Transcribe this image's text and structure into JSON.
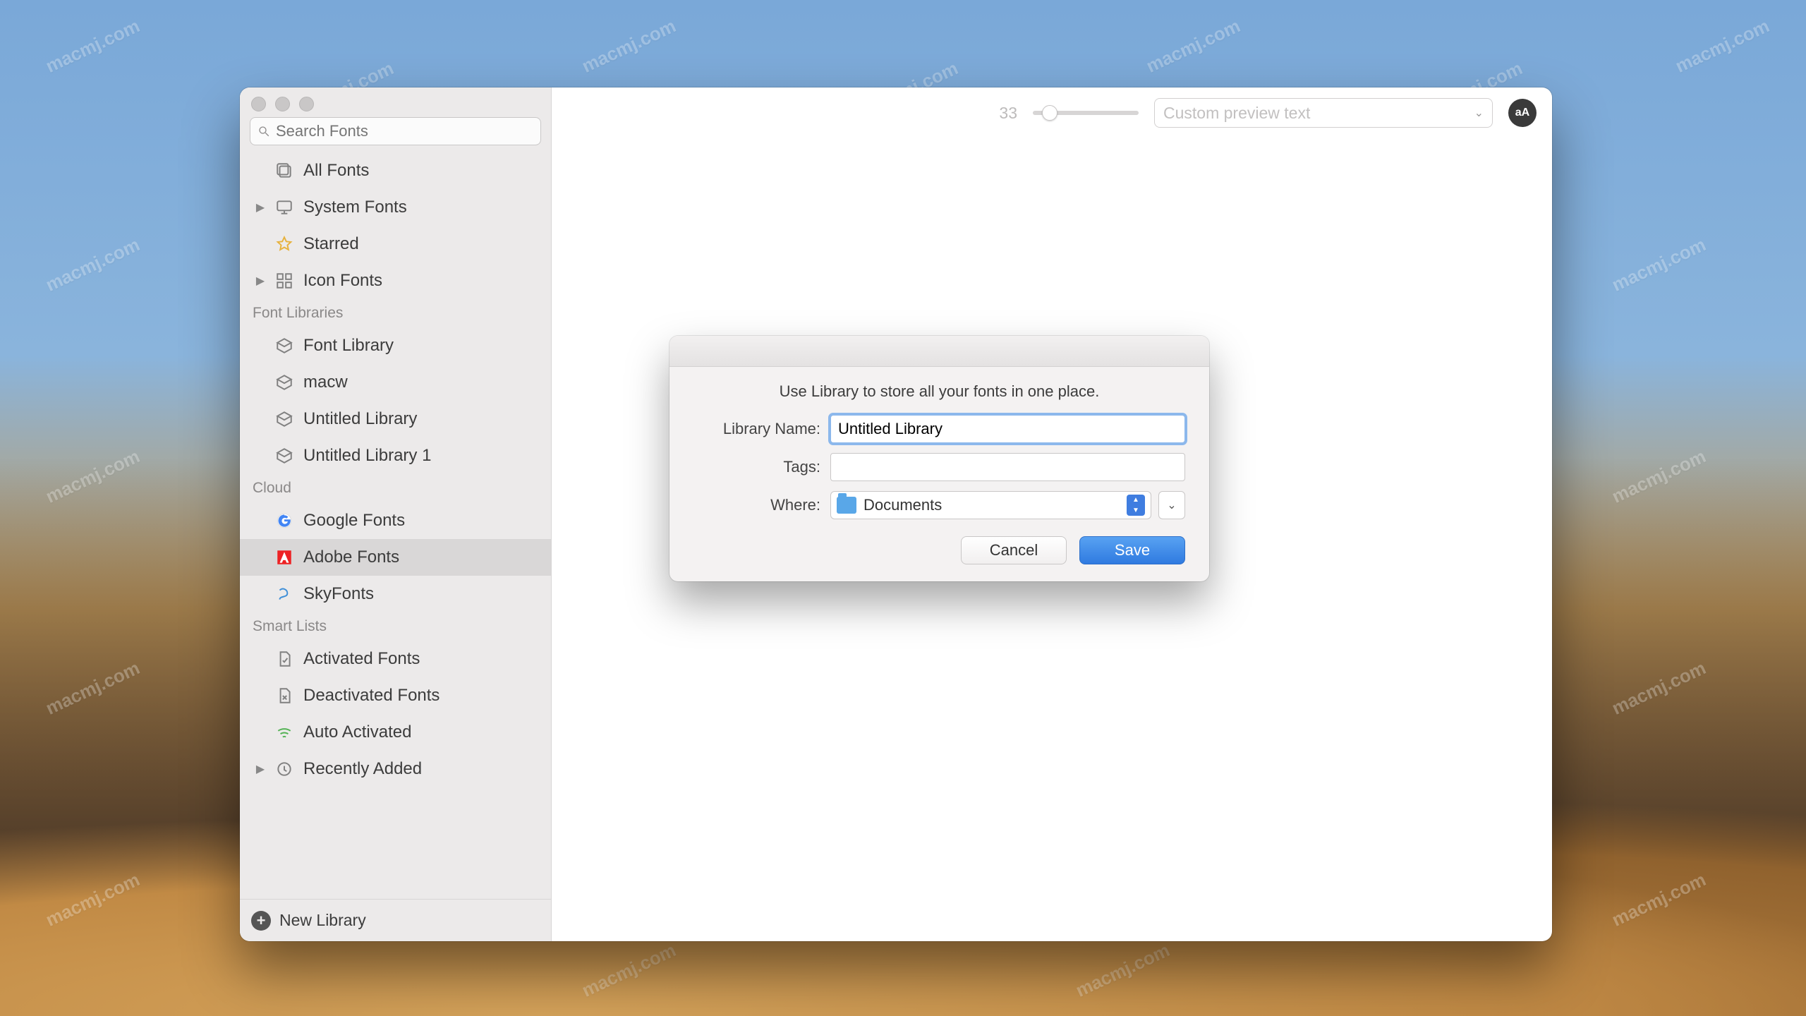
{
  "watermark_text": "macmj.com",
  "toolbar": {
    "font_size_value": "33",
    "preview_placeholder": "Custom preview text",
    "aa_badge": "aA"
  },
  "search": {
    "placeholder": "Search Fonts"
  },
  "sidebar": {
    "groups": [
      {
        "items": [
          {
            "label": "All Fonts"
          },
          {
            "label": "System Fonts"
          },
          {
            "label": "Starred"
          },
          {
            "label": "Icon Fonts"
          }
        ]
      }
    ],
    "font_libraries_header": "Font Libraries",
    "font_libraries": [
      {
        "label": "Font Library"
      },
      {
        "label": "macw"
      },
      {
        "label": "Untitled Library"
      },
      {
        "label": "Untitled Library 1"
      }
    ],
    "cloud_header": "Cloud",
    "cloud": [
      {
        "label": "Google Fonts"
      },
      {
        "label": "Adobe Fonts"
      },
      {
        "label": "SkyFonts"
      }
    ],
    "smart_header": "Smart Lists",
    "smart": [
      {
        "label": "Activated Fonts"
      },
      {
        "label": "Deactivated Fonts"
      },
      {
        "label": "Auto Activated"
      },
      {
        "label": "Recently Added"
      }
    ],
    "footer_label": "New Library"
  },
  "modal": {
    "message": "Use Library to store all your fonts in one place.",
    "name_label": "Library Name:",
    "name_value": "Untitled Library",
    "tags_label": "Tags:",
    "tags_value": "",
    "where_label": "Where:",
    "where_value": "Documents",
    "cancel": "Cancel",
    "save": "Save"
  }
}
